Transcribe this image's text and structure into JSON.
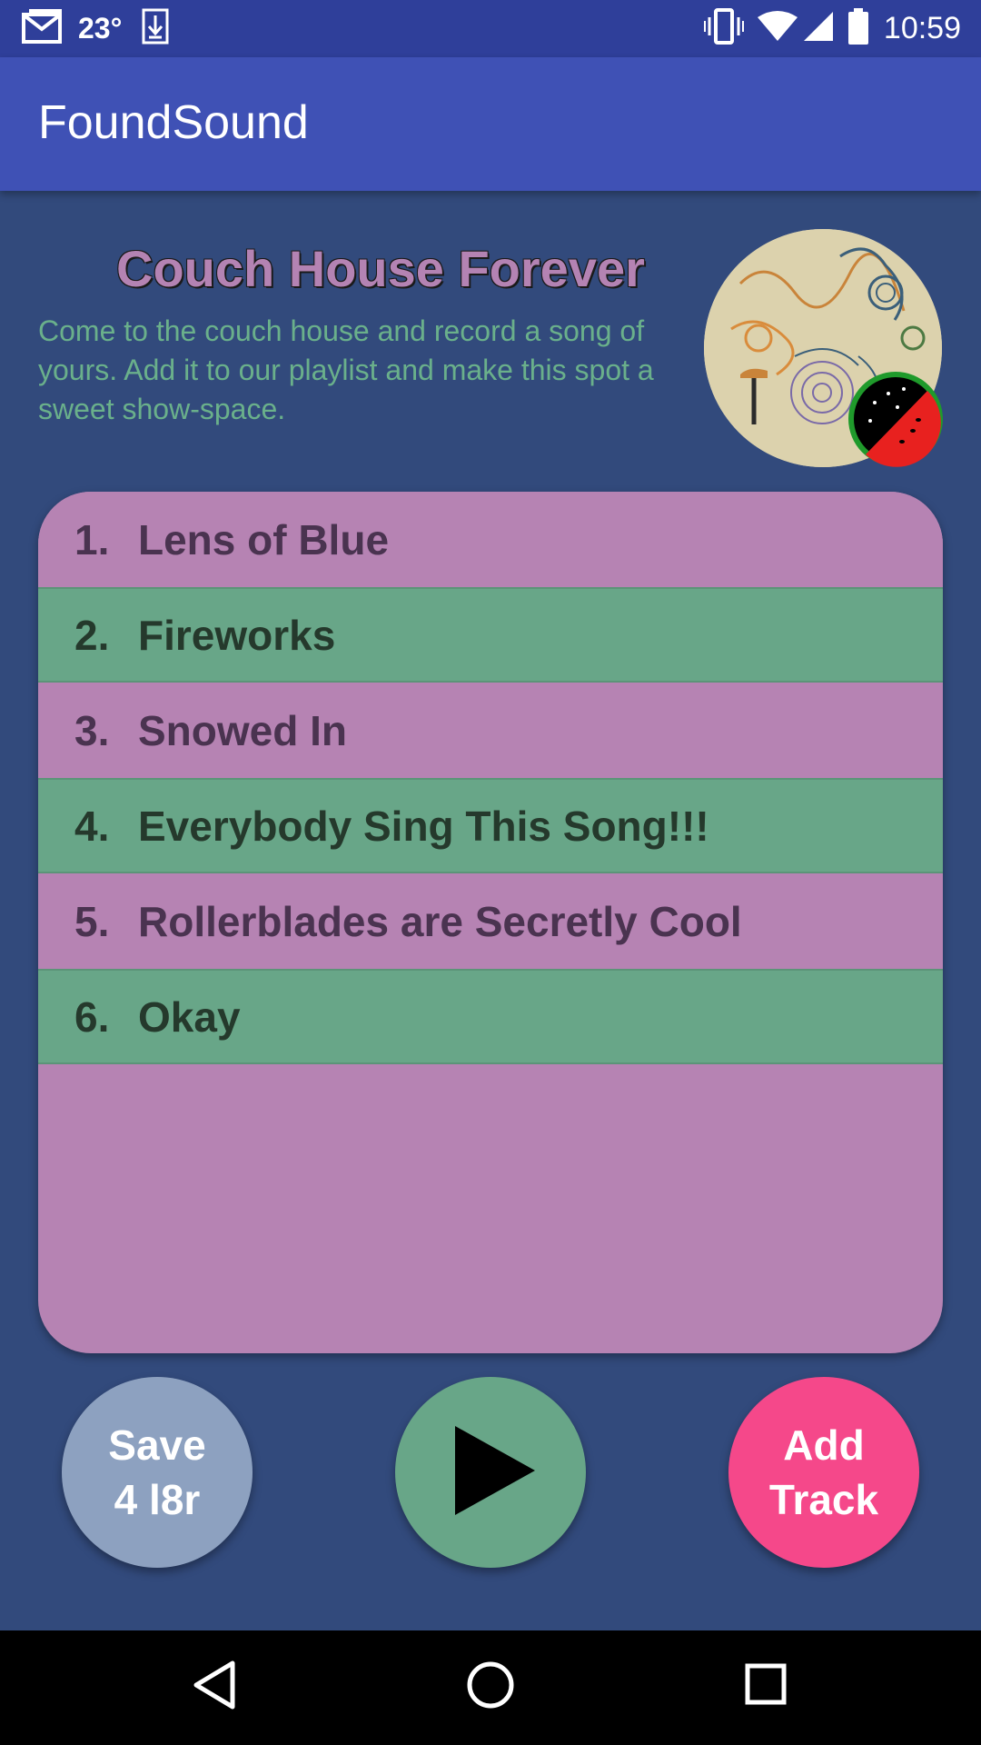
{
  "status_bar": {
    "temperature": "23°",
    "time": "10:59",
    "icons": [
      "gmail-icon",
      "download-icon",
      "vibrate-icon",
      "wifi-icon",
      "signal-icon",
      "battery-icon"
    ]
  },
  "app_bar": {
    "title": "FoundSound"
  },
  "playlist": {
    "title": "Couch House Forever",
    "description": "Come to the couch house and record a song of yours. Add it to our playlist and make this spot a sweet show-space."
  },
  "tracks": [
    {
      "number": "1.",
      "title": "Lens of Blue"
    },
    {
      "number": "2.",
      "title": "Fireworks"
    },
    {
      "number": "3.",
      "title": "Snowed In"
    },
    {
      "number": "4.",
      "title": "Everybody Sing This Song!!!"
    },
    {
      "number": "5.",
      "title": "Rollerblades are Secretly Cool"
    },
    {
      "number": "6.",
      "title": "Okay"
    }
  ],
  "actions": {
    "save_label": "Save\n4 l8r",
    "play_icon": "play-icon",
    "add_label": "Add\nTrack"
  },
  "colors": {
    "background": "#324a7c",
    "app_bar": "#3f51b5",
    "status_bar": "#2f3f9a",
    "purple": "#b683b3",
    "green": "#68a688",
    "save_button": "#8da1c0",
    "add_button": "#f5488a"
  },
  "nav_bar": {
    "icons": [
      "back-icon",
      "home-icon",
      "recents-icon"
    ]
  }
}
